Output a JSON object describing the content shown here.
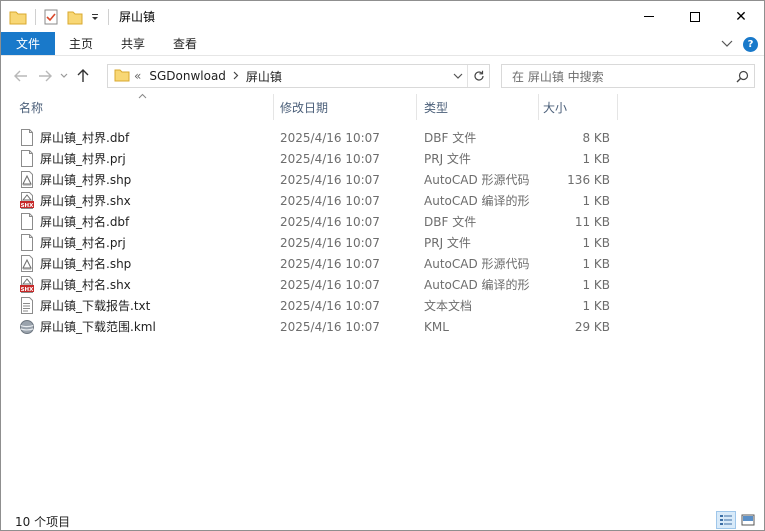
{
  "window": {
    "title": "屏山镇",
    "controls": {
      "minimize_icon": "minimize-icon",
      "maximize_icon": "maximize-icon",
      "close_label": "✕"
    }
  },
  "ribbon": {
    "tabs": [
      {
        "label": "文件"
      },
      {
        "label": "主页"
      },
      {
        "label": "共享"
      },
      {
        "label": "查看"
      }
    ],
    "accent": "#1979ca",
    "help_label": "?"
  },
  "address": {
    "overflow_label": "«",
    "crumbs": [
      "SGDonwload",
      "屏山镇"
    ],
    "search_placeholder": "在 屏山镇 中搜索"
  },
  "columns": {
    "name": "名称",
    "date": "修改日期",
    "type": "类型",
    "size": "大小"
  },
  "files": [
    {
      "name": "屏山镇_村界.dbf",
      "date": "2025/4/16 10:07",
      "type": "DBF 文件",
      "size": "8 KB",
      "icon": "blank-file-icon"
    },
    {
      "name": "屏山镇_村界.prj",
      "date": "2025/4/16 10:07",
      "type": "PRJ 文件",
      "size": "1 KB",
      "icon": "blank-file-icon"
    },
    {
      "name": "屏山镇_村界.shp",
      "date": "2025/4/16 10:07",
      "type": "AutoCAD 形源代码",
      "size": "136 KB",
      "icon": "autocad-shape-icon"
    },
    {
      "name": "屏山镇_村界.shx",
      "date": "2025/4/16 10:07",
      "type": "AutoCAD 编译的形",
      "size": "1 KB",
      "icon": "shx-file-icon"
    },
    {
      "name": "屏山镇_村名.dbf",
      "date": "2025/4/16 10:07",
      "type": "DBF 文件",
      "size": "11 KB",
      "icon": "blank-file-icon"
    },
    {
      "name": "屏山镇_村名.prj",
      "date": "2025/4/16 10:07",
      "type": "PRJ 文件",
      "size": "1 KB",
      "icon": "blank-file-icon"
    },
    {
      "name": "屏山镇_村名.shp",
      "date": "2025/4/16 10:07",
      "type": "AutoCAD 形源代码",
      "size": "1 KB",
      "icon": "autocad-shape-icon"
    },
    {
      "name": "屏山镇_村名.shx",
      "date": "2025/4/16 10:07",
      "type": "AutoCAD 编译的形",
      "size": "1 KB",
      "icon": "shx-file-icon"
    },
    {
      "name": "屏山镇_下载报告.txt",
      "date": "2025/4/16 10:07",
      "type": "文本文档",
      "size": "1 KB",
      "icon": "text-file-icon"
    },
    {
      "name": "屏山镇_下载范围.kml",
      "date": "2025/4/16 10:07",
      "type": "KML",
      "size": "29 KB",
      "icon": "kml-globe-icon"
    }
  ],
  "status": {
    "count": "10 个项目"
  }
}
